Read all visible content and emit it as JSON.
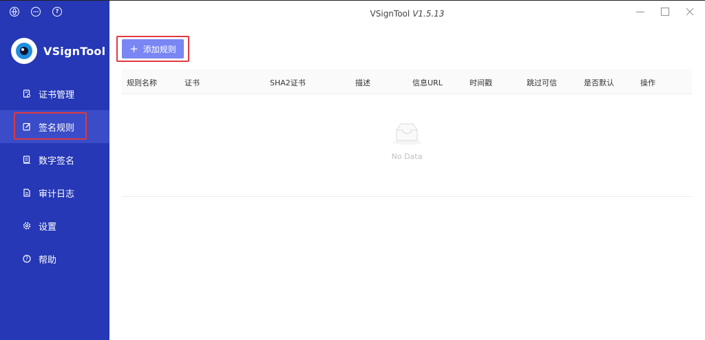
{
  "sidebar": {
    "brand_name": "VSignTool",
    "top_icons": [
      "globe-icon",
      "chat-icon",
      "help-icon"
    ],
    "items": [
      {
        "label": "证书管理",
        "icon": "certificate-icon"
      },
      {
        "label": "签名规则",
        "icon": "edit-icon",
        "active": true
      },
      {
        "label": "数字签名",
        "icon": "signature-icon"
      },
      {
        "label": "审计日志",
        "icon": "log-icon"
      },
      {
        "label": "设置",
        "icon": "gear-icon"
      },
      {
        "label": "帮助",
        "icon": "help-icon"
      }
    ]
  },
  "window": {
    "title": "VSignTool",
    "version": "V1.5.13",
    "controls": [
      "minimize-icon",
      "maximize-icon",
      "close-icon"
    ]
  },
  "toolbar": {
    "add_label": "添加规则"
  },
  "table": {
    "columns": [
      "规则名称",
      "证书",
      "SHA2证书",
      "描述",
      "信息URL",
      "时间戳",
      "跳过可信",
      "是否默认",
      "操作"
    ],
    "rows": [],
    "empty_text": "No Data"
  },
  "colors": {
    "sidebar_bg": "#2638b5",
    "active_item_bg": "#3a4cc7",
    "primary_button": "#7986f3",
    "highlight_border": "#e0393e"
  }
}
